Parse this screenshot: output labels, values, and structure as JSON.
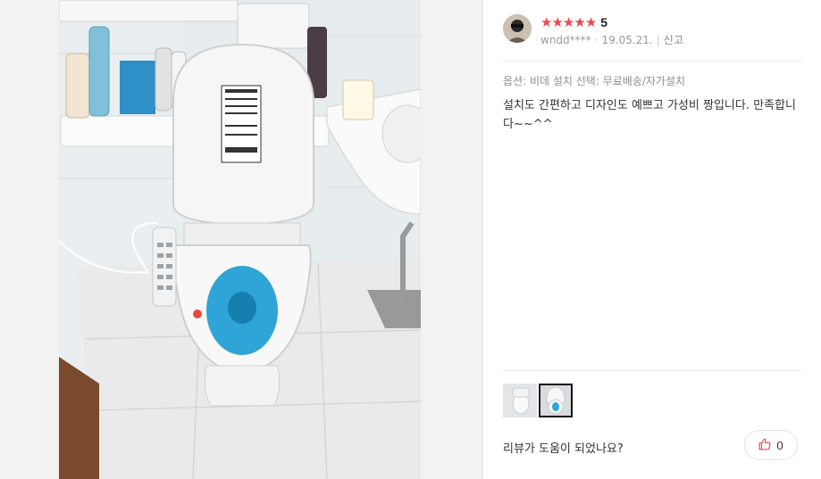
{
  "review": {
    "rating": "5",
    "stars": [
      "★",
      "★",
      "★",
      "★",
      "★"
    ],
    "username": "wndd****",
    "date": "19.05.21.",
    "report_label": "신고",
    "option_text": "옵션: 비데 설치 선택: 무료배송/자가설치",
    "body": "설치도 간편하고 디자인도 예쁘고 가성비 짱입니다. 만족합니다~~^^",
    "helpful_question": "리뷰가 도움이 되었나요?",
    "like_count": "0"
  },
  "colors": {
    "star": "#f0474e",
    "like_icon": "#f0474e"
  },
  "icons": {
    "like": "thumbs-up-icon"
  }
}
